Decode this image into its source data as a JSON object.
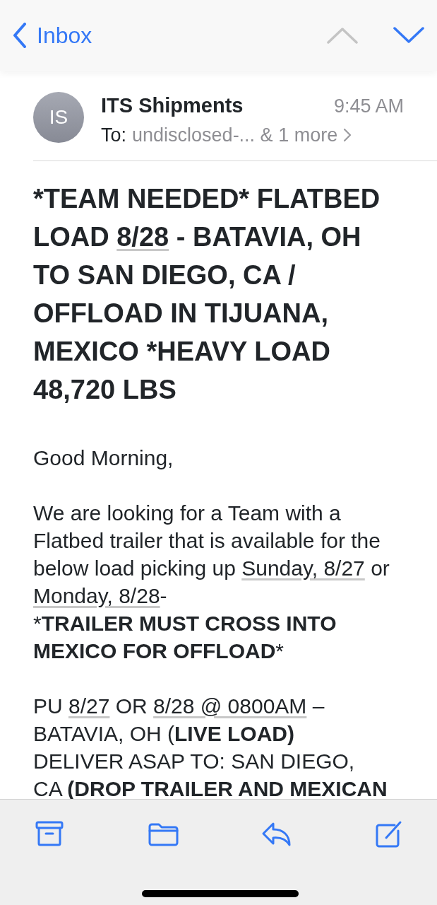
{
  "nav": {
    "back_label": "Inbox",
    "previous": {
      "disabled": true
    },
    "next": {
      "disabled": false
    }
  },
  "sender": {
    "initials": "IS",
    "name": "ITS Shipments",
    "time": "9:45 AM",
    "to_label": "To:",
    "recipients": "undisclosed-... & 1 more"
  },
  "subject": [
    {
      "kind": "text",
      "text": "*TEAM NEEDED* FLATBED LOAD "
    },
    {
      "kind": "date",
      "text": "8/28"
    },
    {
      "kind": "text",
      "text": " - BATAVIA, OH TO SAN DIEGO, CA / OFFLOAD IN TIJUANA, MEXICO *HEAVY LOAD 48,720 LBS"
    }
  ],
  "body": [
    {
      "lines": [
        {
          "runs": [
            {
              "kind": "text",
              "text": "Good Morning,"
            }
          ]
        }
      ]
    },
    {
      "lines": [
        {
          "runs": [
            {
              "kind": "text",
              "text": "We are looking for a Team with a Flatbed trailer that is available for the below load picking up "
            },
            {
              "kind": "date",
              "text": "Sunday, 8/27"
            },
            {
              "kind": "text",
              "text": " or "
            },
            {
              "kind": "date",
              "text": "Monday, 8/28"
            },
            {
              "kind": "text",
              "text": "-"
            }
          ]
        },
        {
          "runs": [
            {
              "kind": "text",
              "text": "*"
            },
            {
              "kind": "bold",
              "text": "TRAILER MUST CROSS INTO MEXICO FOR OFFLOAD"
            },
            {
              "kind": "text",
              "text": "*"
            }
          ]
        }
      ]
    },
    {
      "lines": [
        {
          "runs": [
            {
              "kind": "text",
              "text": "PU "
            },
            {
              "kind": "date",
              "text": "8/27"
            },
            {
              "kind": "text",
              "text": " OR "
            },
            {
              "kind": "date",
              "text": "8/28 @ 0800AM"
            },
            {
              "kind": "text",
              "text": " – BATAVIA, OH ("
            },
            {
              "kind": "bold",
              "text": "LIVE LOAD)"
            }
          ]
        },
        {
          "runs": [
            {
              "kind": "text",
              "text": "DELIVER ASAP TO: SAN DIEGO, "
            },
            {
              "kind": "group",
              "runs": [
                {
                  "kind": "text",
                  "text": "CA "
                },
                {
                  "kind": "bold",
                  "text": "(DROP TRAILER AND MEXICAN"
                }
              ]
            }
          ]
        }
      ]
    }
  ],
  "toolbar": [
    {
      "kind": "archive"
    },
    {
      "kind": "folder"
    },
    {
      "kind": "reply"
    },
    {
      "kind": "compose"
    }
  ]
}
